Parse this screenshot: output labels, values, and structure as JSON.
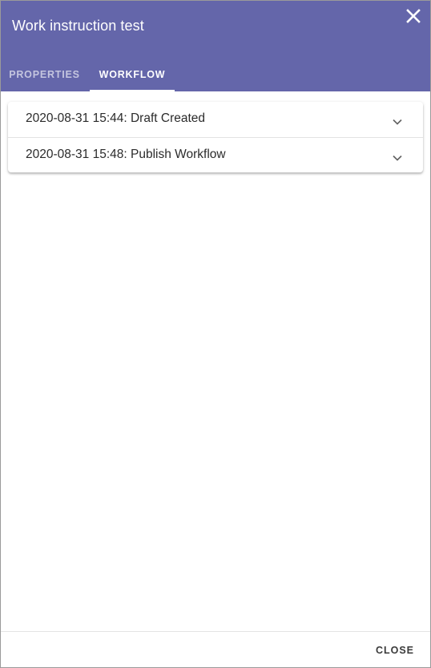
{
  "dialog": {
    "title": "Work instruction test",
    "close_icon": "close-icon"
  },
  "tabs": [
    {
      "label": "PROPERTIES",
      "active": false
    },
    {
      "label": "WORKFLOW",
      "active": true
    }
  ],
  "workflow": {
    "items": [
      {
        "label": "2020-08-31 15:44: Draft Created",
        "icon": "chevron-down-icon"
      },
      {
        "label": "2020-08-31 15:48: Publish Workflow",
        "icon": "chevron-down-icon"
      }
    ]
  },
  "footer": {
    "close_label": "CLOSE"
  },
  "colors": {
    "header": "#6466aa",
    "header_text": "#ffffff"
  }
}
